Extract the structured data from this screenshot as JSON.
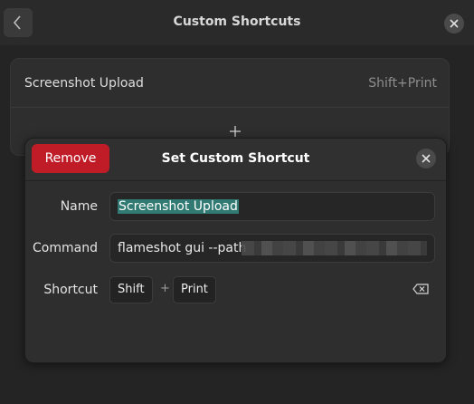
{
  "window": {
    "title": "Custom Shortcuts"
  },
  "shortcuts": [
    {
      "name": "Screenshot Upload",
      "accel": "Shift+Print"
    }
  ],
  "dialog": {
    "title": "Set Custom Shortcut",
    "remove_label": "Remove",
    "name_label": "Name",
    "name_value": "Screenshot Upload",
    "command_label": "Command",
    "command_value": "flameshot gui --path",
    "shortcut_label": "Shortcut",
    "keys": [
      "Shift",
      "Print"
    ],
    "key_separator": "+"
  },
  "colors": {
    "destructive": "#c01c28",
    "selection": "#317a73"
  },
  "icons": {
    "back": "go-previous-icon",
    "close": "window-close-icon",
    "add": "list-add-icon",
    "clear": "edit-clear-icon"
  }
}
